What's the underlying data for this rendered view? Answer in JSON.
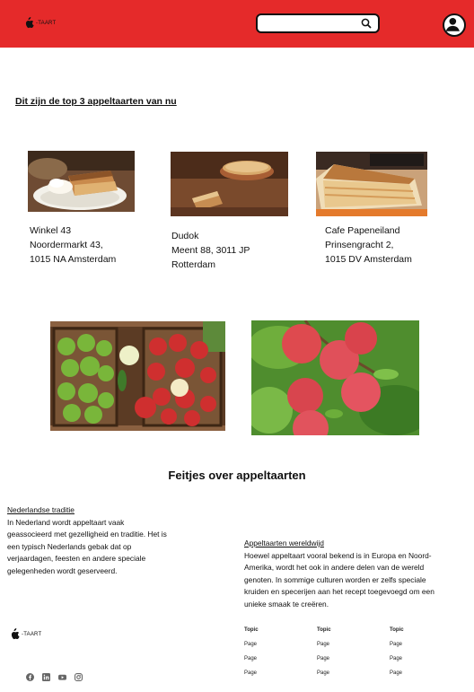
{
  "header": {
    "brand": "-TAART",
    "search_placeholder": "",
    "icons": {
      "logo": "apple-icon",
      "search": "search-icon",
      "profile": "user-icon"
    },
    "colors": {
      "bar": "#e52a2a"
    }
  },
  "main": {
    "title": "Dit zijn de top 3 appeltaarten van nu",
    "shops": [
      {
        "lines": [
          "Winkel 43",
          "Noordermarkt 43,",
          "1015 NA Amsterdam"
        ]
      },
      {
        "lines": [
          "Dudok",
          "Meent 88, 3011 JP",
          "Rotterdam"
        ]
      },
      {
        "lines": [
          "Cafe Papeneiland",
          "Prinsengracht 2,",
          "1015 DV Amsterdam"
        ]
      }
    ]
  },
  "facts": {
    "title": "Feitjes over appeltaarten",
    "items": [
      {
        "heading": " Nederlandse traditie",
        "lines": [
          "In  Nederland wordt appeltaart vaak",
          "geassocieerd met gezelligheid en  traditie. Het is",
          "een typisch Nederlands gebak dat op",
          "verjaardagen,  feesten en andere speciale",
          "gelegenheden wordt geserveerd."
        ]
      },
      {
        "heading": "Appeltaarten wereldwijd",
        "lines": [
          "Hoewel  appeltaart vooral bekend is in Europa en Noord-",
          "Amerika, wordt het ook  in andere delen van de wereld",
          "genoten. In sommige culturen worden er  zelfs speciale",
          "kruiden en specerijen aan het recept toegevoegd om een",
          "unieke smaak te creëren."
        ]
      }
    ]
  },
  "footer": {
    "brand": "-TAART",
    "socials": [
      "facebook-icon",
      "linkedin-icon",
      "youtube-icon",
      "instagram-icon"
    ],
    "columns": [
      {
        "topic": "Topic",
        "pages": [
          "Page",
          "Page",
          "Page"
        ]
      },
      {
        "topic": "Topic",
        "pages": [
          "Page",
          "Page",
          "Page"
        ]
      },
      {
        "topic": "Topic",
        "pages": [
          "Page",
          "Page",
          "Page"
        ]
      }
    ]
  }
}
